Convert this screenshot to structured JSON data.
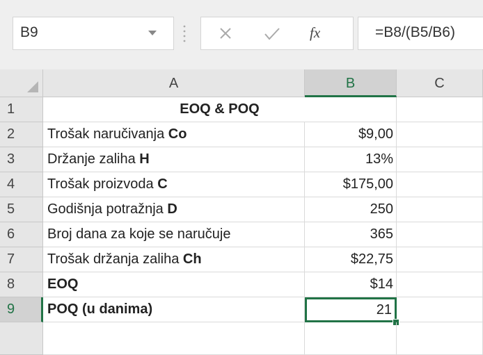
{
  "name_box": {
    "value": "B9"
  },
  "formula_bar": {
    "fx_label": "fx",
    "formula": "=B8/(B5/B6)"
  },
  "columns": [
    "A",
    "B",
    "C"
  ],
  "selected_column": "B",
  "selected_row": "9",
  "accent_color": "#217346",
  "rows": [
    {
      "num": "1",
      "title": "EOQ & POQ"
    },
    {
      "num": "2",
      "label": "Trošak naručivanja ",
      "label_bold": "Co",
      "value": "$9,00"
    },
    {
      "num": "3",
      "label": "Držanje zaliha ",
      "label_bold": "H",
      "value": "13%"
    },
    {
      "num": "4",
      "label": "Trošak proizvoda ",
      "label_bold": "C",
      "value": "$175,00"
    },
    {
      "num": "5",
      "label": "Godišnja potražnja ",
      "label_bold": "D",
      "value": "250"
    },
    {
      "num": "6",
      "label": "Broj dana za koje se naručuje",
      "label_bold": "",
      "value": "365"
    },
    {
      "num": "7",
      "label": "Trošak držanja zaliha ",
      "label_bold": "Ch",
      "value": "$22,75"
    },
    {
      "num": "8",
      "label": "",
      "label_bold": "EOQ",
      "value": "$14"
    },
    {
      "num": "9",
      "label": "",
      "label_bold": "POQ (u danima)",
      "value": "21"
    }
  ],
  "icons": [
    "dropdown-arrow-icon",
    "cancel-x-icon",
    "enter-check-icon",
    "insert-function-icon",
    "select-all-triangle-icon"
  ]
}
